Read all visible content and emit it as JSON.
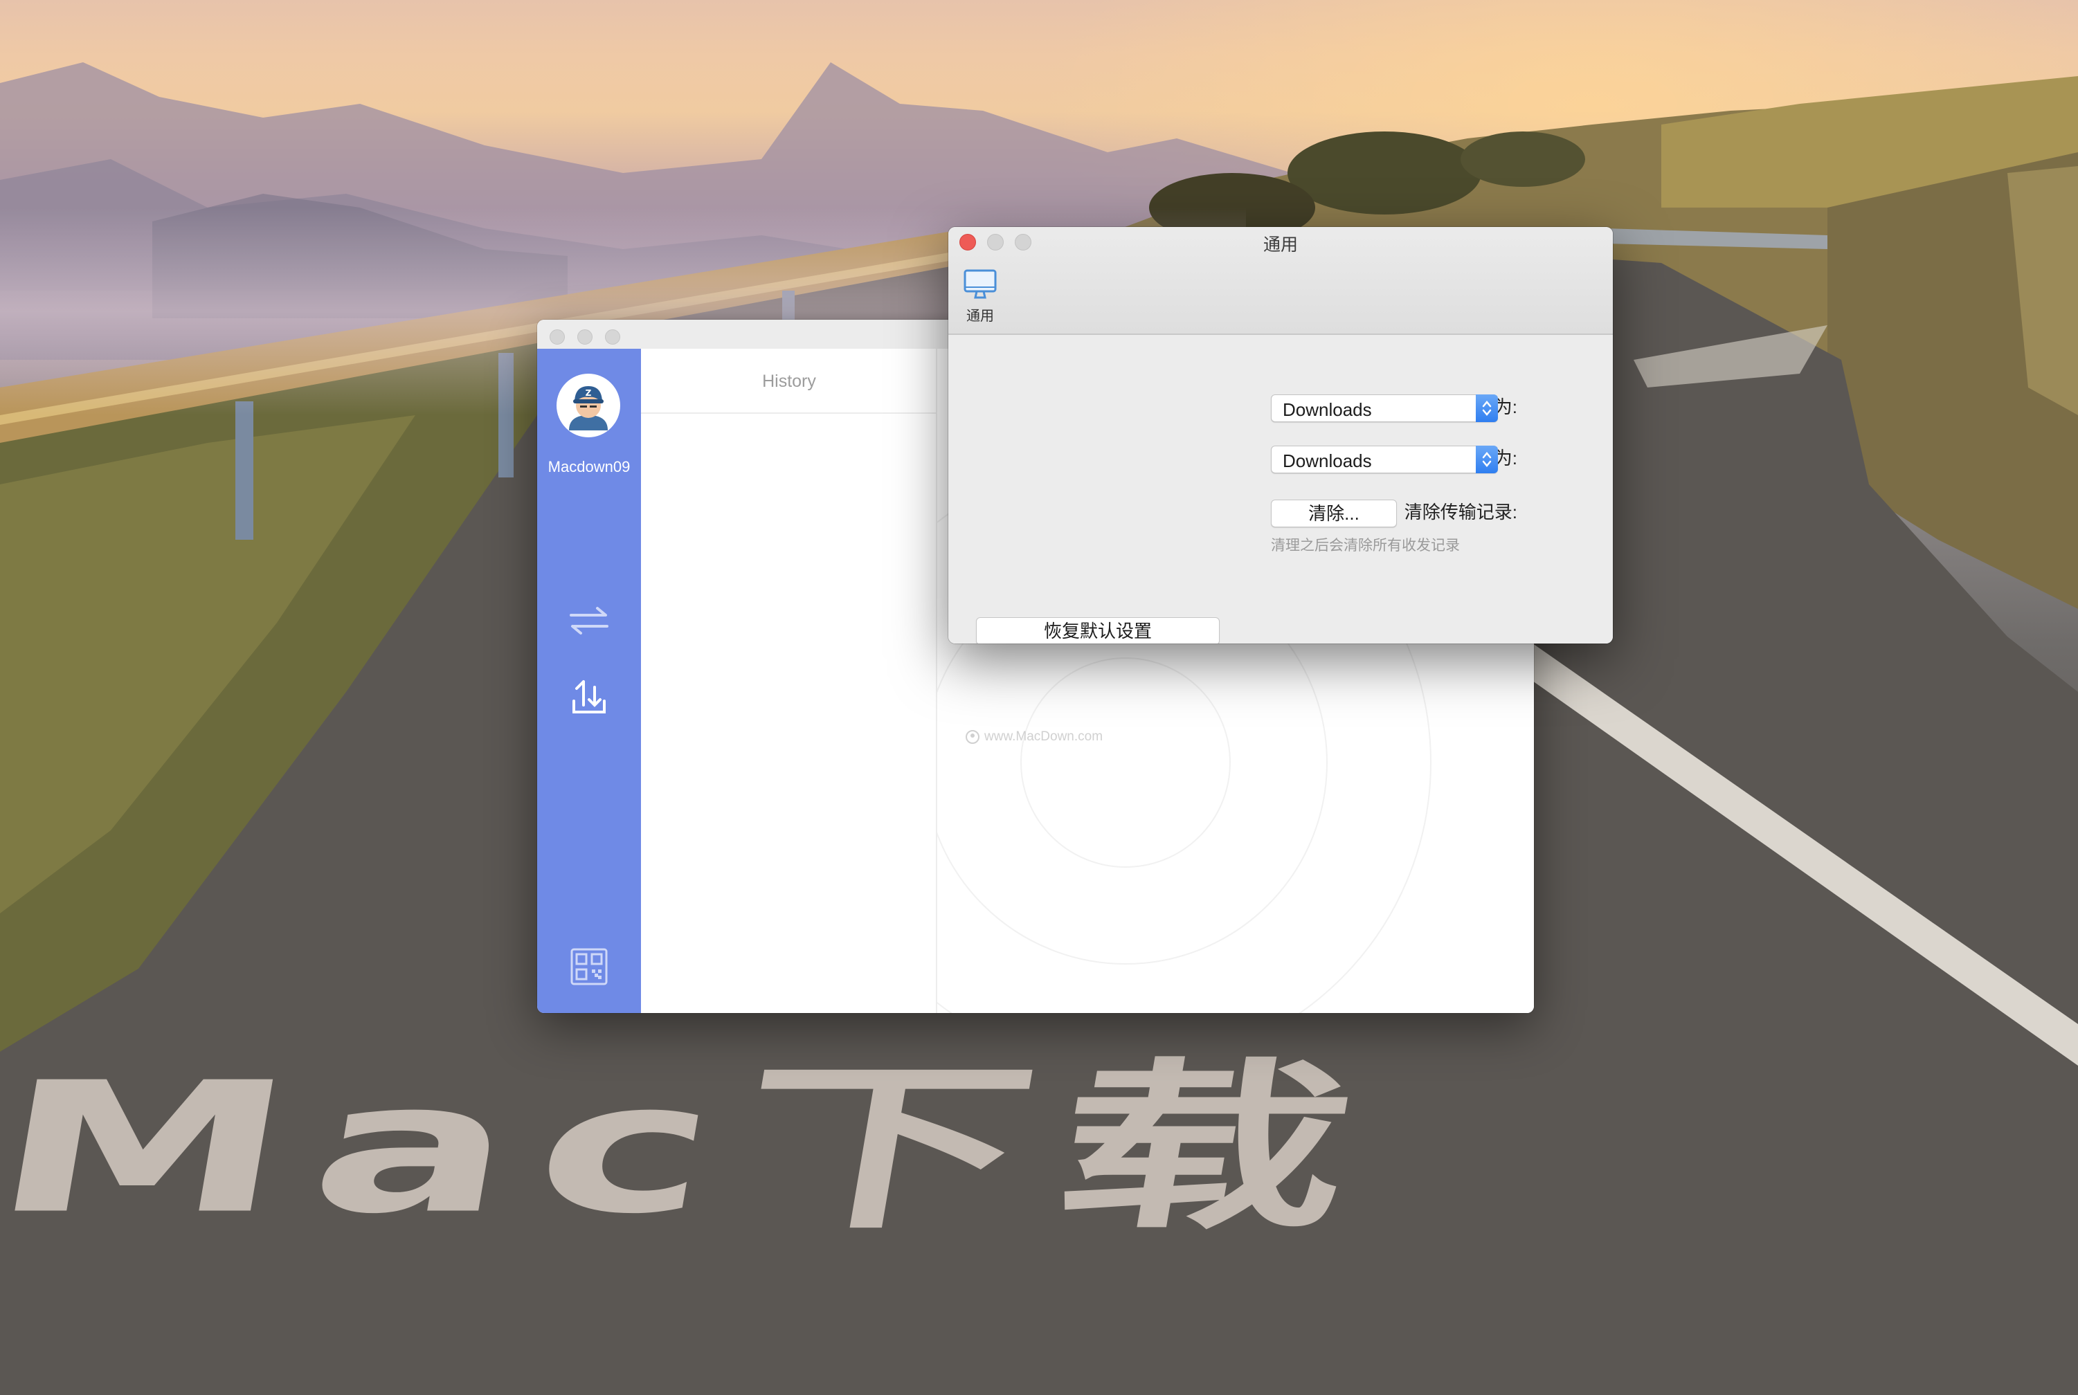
{
  "wallpaper": {
    "text": "Mac下载"
  },
  "app_window": {
    "username": "Macdown09",
    "history_header": "History",
    "watermark": "www.MacDown.com",
    "sidebar_icons": [
      "avatar",
      "transfer-arrows-icon",
      "upload-icon",
      "qr-code-icon"
    ]
  },
  "prefs_window": {
    "title": "通用",
    "toolbar": {
      "general_label": "通用",
      "general_icon": "monitor-icon"
    },
    "browse_path": {
      "label": "将浏览路径设置为:",
      "value": "Downloads"
    },
    "backup_path": {
      "label": "将备份的路径设置为:",
      "value": "Downloads"
    },
    "clear_history": {
      "label": "清除传输记录:",
      "button": "清除...",
      "hint": "清理之后会清除所有收发记录"
    },
    "restore_button": "恢复默认设置"
  }
}
